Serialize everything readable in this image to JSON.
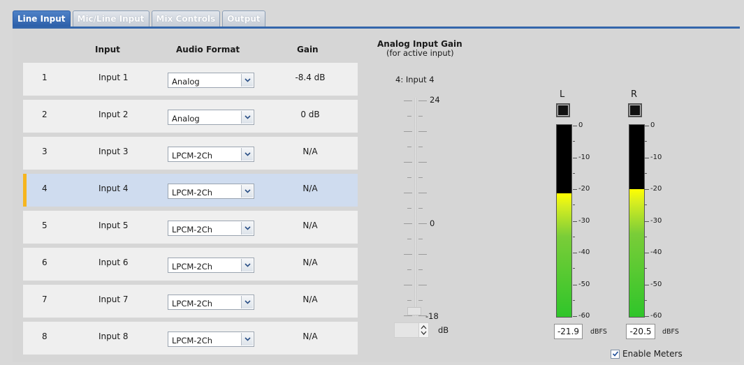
{
  "tabs": [
    {
      "label": "Line Input",
      "active": true
    },
    {
      "label": "Mic/Line Input",
      "active": false
    },
    {
      "label": "Mix Controls",
      "active": false
    },
    {
      "label": "Output",
      "active": false
    }
  ],
  "table": {
    "headers": {
      "input": "Input",
      "format": "Audio Format",
      "gain": "Gain"
    },
    "rows": [
      {
        "num": "1",
        "name": "Input 1",
        "format": "Analog",
        "gain": "-8.4 dB"
      },
      {
        "num": "2",
        "name": "Input 2",
        "format": "Analog",
        "gain": "0 dB"
      },
      {
        "num": "3",
        "name": "Input 3",
        "format": "LPCM-2Ch",
        "gain": "N/A"
      },
      {
        "num": "4",
        "name": "Input 4",
        "format": "LPCM-2Ch",
        "gain": "N/A"
      },
      {
        "num": "5",
        "name": "Input 5",
        "format": "LPCM-2Ch",
        "gain": "N/A"
      },
      {
        "num": "6",
        "name": "Input 6",
        "format": "LPCM-2Ch",
        "gain": "N/A"
      },
      {
        "num": "7",
        "name": "Input 7",
        "format": "LPCM-2Ch",
        "gain": "N/A"
      },
      {
        "num": "8",
        "name": "Input 8",
        "format": "LPCM-2Ch",
        "gain": "N/A"
      }
    ],
    "selected_row": 4
  },
  "analog_gain": {
    "title": "Analog Input Gain",
    "subtitle": "(for active input)",
    "active_input": "4: Input 4",
    "scale_top": "24",
    "scale_mid": "0",
    "scale_bottom": "-18",
    "unit": "dB",
    "value": ""
  },
  "meters": {
    "left": {
      "label": "L",
      "readout": "-21.9",
      "unit": "dBFS",
      "level_fraction": 0.645
    },
    "right": {
      "label": "R",
      "readout": "-20.5",
      "unit": "dBFS",
      "level_fraction": 0.665
    },
    "scale": [
      "0",
      "-10",
      "-20",
      "-30",
      "-40",
      "-50",
      "-60"
    ],
    "enable_meters_label": "Enable Meters",
    "enable_meters_checked": true
  },
  "colors": {
    "tab_active": "#2b5ea8",
    "selected_row": "#cfdcef",
    "row_accent": "#f6b51e",
    "meter_green": "#2fc52a",
    "meter_yellow": "#ffff00"
  }
}
